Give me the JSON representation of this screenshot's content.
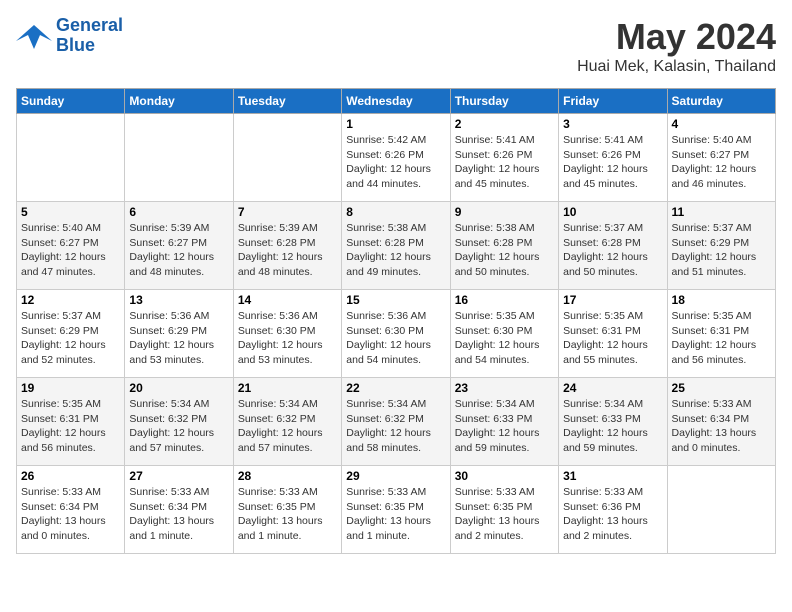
{
  "header": {
    "logo_line1": "General",
    "logo_line2": "Blue",
    "month": "May 2024",
    "location": "Huai Mek, Kalasin, Thailand"
  },
  "days_of_week": [
    "Sunday",
    "Monday",
    "Tuesday",
    "Wednesday",
    "Thursday",
    "Friday",
    "Saturday"
  ],
  "weeks": [
    [
      {
        "day": "",
        "info": ""
      },
      {
        "day": "",
        "info": ""
      },
      {
        "day": "",
        "info": ""
      },
      {
        "day": "1",
        "info": "Sunrise: 5:42 AM\nSunset: 6:26 PM\nDaylight: 12 hours\nand 44 minutes."
      },
      {
        "day": "2",
        "info": "Sunrise: 5:41 AM\nSunset: 6:26 PM\nDaylight: 12 hours\nand 45 minutes."
      },
      {
        "day": "3",
        "info": "Sunrise: 5:41 AM\nSunset: 6:26 PM\nDaylight: 12 hours\nand 45 minutes."
      },
      {
        "day": "4",
        "info": "Sunrise: 5:40 AM\nSunset: 6:27 PM\nDaylight: 12 hours\nand 46 minutes."
      }
    ],
    [
      {
        "day": "5",
        "info": "Sunrise: 5:40 AM\nSunset: 6:27 PM\nDaylight: 12 hours\nand 47 minutes."
      },
      {
        "day": "6",
        "info": "Sunrise: 5:39 AM\nSunset: 6:27 PM\nDaylight: 12 hours\nand 48 minutes."
      },
      {
        "day": "7",
        "info": "Sunrise: 5:39 AM\nSunset: 6:28 PM\nDaylight: 12 hours\nand 48 minutes."
      },
      {
        "day": "8",
        "info": "Sunrise: 5:38 AM\nSunset: 6:28 PM\nDaylight: 12 hours\nand 49 minutes."
      },
      {
        "day": "9",
        "info": "Sunrise: 5:38 AM\nSunset: 6:28 PM\nDaylight: 12 hours\nand 50 minutes."
      },
      {
        "day": "10",
        "info": "Sunrise: 5:37 AM\nSunset: 6:28 PM\nDaylight: 12 hours\nand 50 minutes."
      },
      {
        "day": "11",
        "info": "Sunrise: 5:37 AM\nSunset: 6:29 PM\nDaylight: 12 hours\nand 51 minutes."
      }
    ],
    [
      {
        "day": "12",
        "info": "Sunrise: 5:37 AM\nSunset: 6:29 PM\nDaylight: 12 hours\nand 52 minutes."
      },
      {
        "day": "13",
        "info": "Sunrise: 5:36 AM\nSunset: 6:29 PM\nDaylight: 12 hours\nand 53 minutes."
      },
      {
        "day": "14",
        "info": "Sunrise: 5:36 AM\nSunset: 6:30 PM\nDaylight: 12 hours\nand 53 minutes."
      },
      {
        "day": "15",
        "info": "Sunrise: 5:36 AM\nSunset: 6:30 PM\nDaylight: 12 hours\nand 54 minutes."
      },
      {
        "day": "16",
        "info": "Sunrise: 5:35 AM\nSunset: 6:30 PM\nDaylight: 12 hours\nand 54 minutes."
      },
      {
        "day": "17",
        "info": "Sunrise: 5:35 AM\nSunset: 6:31 PM\nDaylight: 12 hours\nand 55 minutes."
      },
      {
        "day": "18",
        "info": "Sunrise: 5:35 AM\nSunset: 6:31 PM\nDaylight: 12 hours\nand 56 minutes."
      }
    ],
    [
      {
        "day": "19",
        "info": "Sunrise: 5:35 AM\nSunset: 6:31 PM\nDaylight: 12 hours\nand 56 minutes."
      },
      {
        "day": "20",
        "info": "Sunrise: 5:34 AM\nSunset: 6:32 PM\nDaylight: 12 hours\nand 57 minutes."
      },
      {
        "day": "21",
        "info": "Sunrise: 5:34 AM\nSunset: 6:32 PM\nDaylight: 12 hours\nand 57 minutes."
      },
      {
        "day": "22",
        "info": "Sunrise: 5:34 AM\nSunset: 6:32 PM\nDaylight: 12 hours\nand 58 minutes."
      },
      {
        "day": "23",
        "info": "Sunrise: 5:34 AM\nSunset: 6:33 PM\nDaylight: 12 hours\nand 59 minutes."
      },
      {
        "day": "24",
        "info": "Sunrise: 5:34 AM\nSunset: 6:33 PM\nDaylight: 12 hours\nand 59 minutes."
      },
      {
        "day": "25",
        "info": "Sunrise: 5:33 AM\nSunset: 6:34 PM\nDaylight: 13 hours\nand 0 minutes."
      }
    ],
    [
      {
        "day": "26",
        "info": "Sunrise: 5:33 AM\nSunset: 6:34 PM\nDaylight: 13 hours\nand 0 minutes."
      },
      {
        "day": "27",
        "info": "Sunrise: 5:33 AM\nSunset: 6:34 PM\nDaylight: 13 hours\nand 1 minute."
      },
      {
        "day": "28",
        "info": "Sunrise: 5:33 AM\nSunset: 6:35 PM\nDaylight: 13 hours\nand 1 minute."
      },
      {
        "day": "29",
        "info": "Sunrise: 5:33 AM\nSunset: 6:35 PM\nDaylight: 13 hours\nand 1 minute."
      },
      {
        "day": "30",
        "info": "Sunrise: 5:33 AM\nSunset: 6:35 PM\nDaylight: 13 hours\nand 2 minutes."
      },
      {
        "day": "31",
        "info": "Sunrise: 5:33 AM\nSunset: 6:36 PM\nDaylight: 13 hours\nand 2 minutes."
      },
      {
        "day": "",
        "info": ""
      }
    ]
  ]
}
